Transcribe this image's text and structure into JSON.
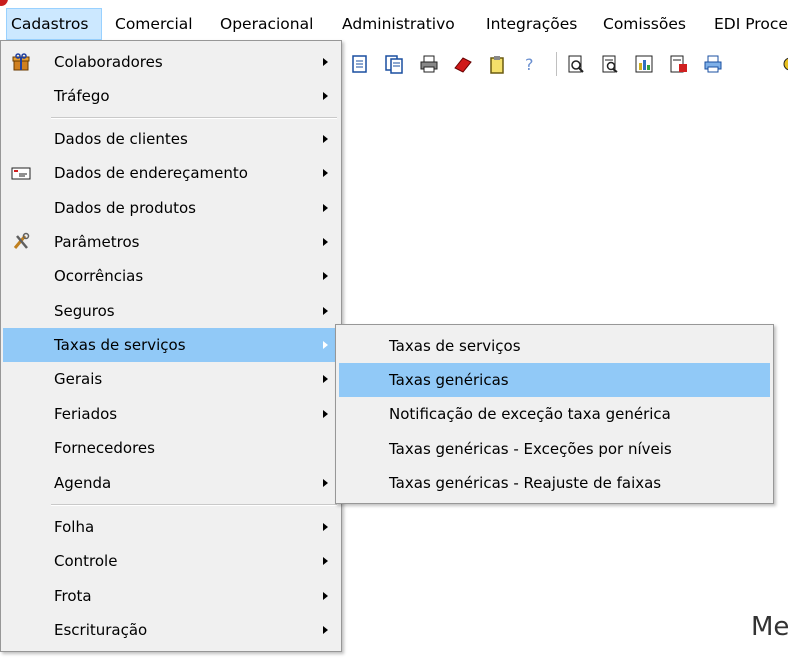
{
  "menubar": {
    "items": [
      {
        "label": "Cadastros",
        "active": true
      },
      {
        "label": "Comercial"
      },
      {
        "label": "Operacional"
      },
      {
        "label": "Administrativo"
      },
      {
        "label": "Integrações"
      },
      {
        "label": "Comissões"
      },
      {
        "label": "EDI Proce"
      }
    ]
  },
  "toolbar": {
    "icons": [
      "document-icon",
      "documents-icon",
      "printer-icon",
      "eraser-icon",
      "clipboard-icon",
      "help-icon",
      "preview-icon",
      "report-preview-icon",
      "chart-report-icon",
      "export-icon",
      "print-icon"
    ]
  },
  "menu": {
    "items": [
      {
        "label": "Colaboradores",
        "submenu": true,
        "icon": "gift-icon"
      },
      {
        "label": "Tráfego",
        "submenu": true
      },
      {
        "label": "Dados de clientes",
        "submenu": true
      },
      {
        "label": "Dados de endereçamento",
        "submenu": true,
        "icon": "envelope-icon"
      },
      {
        "label": "Dados de produtos",
        "submenu": true
      },
      {
        "label": "Parâmetros",
        "submenu": true,
        "icon": "tools-icon"
      },
      {
        "label": "Ocorrências",
        "submenu": true
      },
      {
        "label": "Seguros",
        "submenu": true
      },
      {
        "label": "Taxas de serviços",
        "submenu": true,
        "highlighted": true
      },
      {
        "label": "Gerais",
        "submenu": true
      },
      {
        "label": "Feriados",
        "submenu": true
      },
      {
        "label": "Fornecedores",
        "submenu": false
      },
      {
        "label": "Agenda",
        "submenu": true
      },
      {
        "label": "Folha",
        "submenu": true
      },
      {
        "label": "Controle",
        "submenu": true
      },
      {
        "label": "Frota",
        "submenu": true
      },
      {
        "label": "Escrituração",
        "submenu": true
      }
    ]
  },
  "submenu": {
    "items": [
      {
        "label": "Taxas de serviços"
      },
      {
        "label": "Taxas genéricas",
        "highlighted": true
      },
      {
        "label": "Notificação de exceção taxa genérica"
      },
      {
        "label": "Taxas genéricas - Exceções por níveis"
      },
      {
        "label": "Taxas genéricas - Reajuste de faixas"
      }
    ]
  },
  "background": {
    "partial_text": "Me"
  },
  "colors": {
    "highlight": "#91c9f7",
    "menu_bg": "#f0f0f0",
    "menubar_active": "#cce8ff"
  }
}
